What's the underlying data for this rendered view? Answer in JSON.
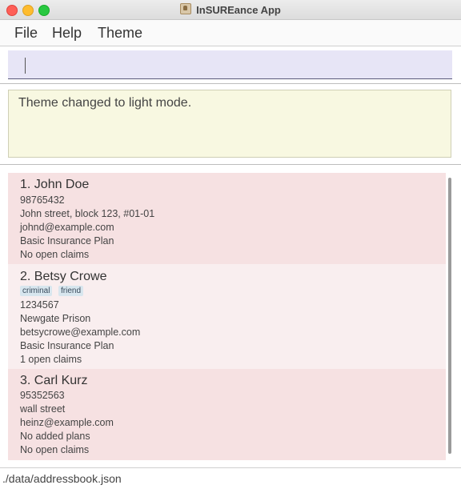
{
  "window": {
    "title": "InSUREance App"
  },
  "menu": {
    "file": "File",
    "help": "Help",
    "theme": "Theme"
  },
  "command": {
    "value": "",
    "placeholder": ""
  },
  "result": {
    "message": "Theme changed to light mode."
  },
  "clients": [
    {
      "name": "1. John Doe",
      "tags": [],
      "phone": "98765432",
      "address": "John street, block 123, #01-01",
      "email": "johnd@example.com",
      "plan": "Basic Insurance Plan",
      "claims": "No open claims"
    },
    {
      "name": "2. Betsy Crowe",
      "tags": [
        "criminal",
        "friend"
      ],
      "phone": "1234567",
      "address": "Newgate Prison",
      "email": "betsycrowe@example.com",
      "plan": "Basic Insurance Plan",
      "claims": "1 open claims"
    },
    {
      "name": "3. Carl Kurz",
      "tags": [],
      "phone": "95352563",
      "address": "wall street",
      "email": "heinz@example.com",
      "plan": "No added plans",
      "claims": "No open claims"
    }
  ],
  "status": {
    "path": "./data/addressbook.json"
  },
  "colors": {
    "card_odd": "#f6e1e2",
    "card_even": "#f9eeef",
    "command_bg": "#e7e5f6",
    "result_bg": "#f8f8e1",
    "tag_bg": "#d8e6ee"
  }
}
